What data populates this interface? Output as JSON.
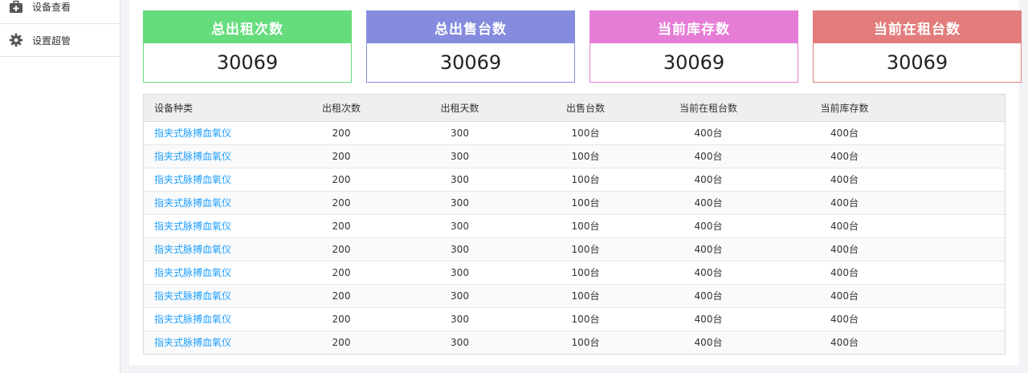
{
  "sidebar": {
    "items": [
      {
        "label": "设备查看",
        "icon": "medkit-icon"
      },
      {
        "label": "设置超管",
        "icon": "gear-icon"
      }
    ]
  },
  "stats": [
    {
      "title": "总出租次数",
      "value": "30069",
      "color": "#66dd7d"
    },
    {
      "title": "总出售台数",
      "value": "30069",
      "color": "#858cde"
    },
    {
      "title": "当前库存数",
      "value": "30069",
      "color": "#e57dd7"
    },
    {
      "title": "当前在租台数",
      "value": "30069",
      "color": "#e37c7c"
    }
  ],
  "table": {
    "headers": [
      "设备种类",
      "出租次数",
      "出租天数",
      "出售台数",
      "当前在租台数",
      "当前库存数"
    ],
    "rows": [
      [
        "指夹式脉搏血氧仪",
        "200",
        "300",
        "100台",
        "400台",
        "400台"
      ],
      [
        "指夹式脉搏血氧仪",
        "200",
        "300",
        "100台",
        "400台",
        "400台"
      ],
      [
        "指夹式脉搏血氧仪",
        "200",
        "300",
        "100台",
        "400台",
        "400台"
      ],
      [
        "指夹式脉搏血氧仪",
        "200",
        "300",
        "100台",
        "400台",
        "400台"
      ],
      [
        "指夹式脉搏血氧仪",
        "200",
        "300",
        "100台",
        "400台",
        "400台"
      ],
      [
        "指夹式脉搏血氧仪",
        "200",
        "300",
        "100台",
        "400台",
        "400台"
      ],
      [
        "指夹式脉搏血氧仪",
        "200",
        "300",
        "100台",
        "400台",
        "400台"
      ],
      [
        "指夹式脉搏血氧仪",
        "200",
        "300",
        "100台",
        "400台",
        "400台"
      ],
      [
        "指夹式脉搏血氧仪",
        "200",
        "300",
        "100台",
        "400台",
        "400台"
      ],
      [
        "指夹式脉搏血氧仪",
        "200",
        "300",
        "100台",
        "400台",
        "400台"
      ]
    ]
  }
}
